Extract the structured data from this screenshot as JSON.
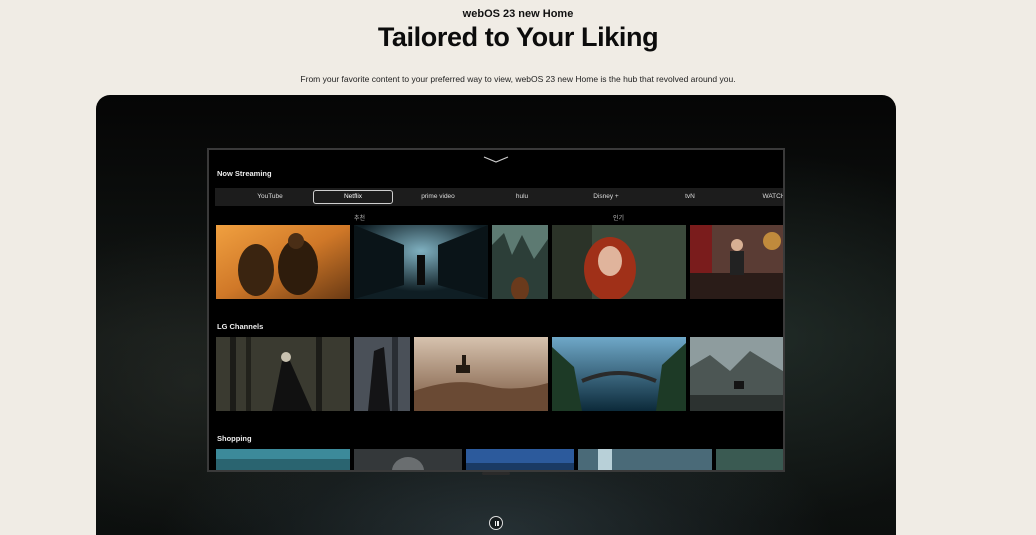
{
  "header": {
    "eyebrow": "webOS 23 new Home",
    "title": "Tailored to Your Liking",
    "description": "From your favorite content to your preferred way to view, webOS 23 new Home is the hub that revolved around you."
  },
  "tv": {
    "now_streaming": {
      "title": "Now Streaming",
      "tabs": [
        {
          "label": "YouTube",
          "active": false
        },
        {
          "label": "Netflix",
          "active": true
        },
        {
          "label": "prime video",
          "active": false
        },
        {
          "label": "hulu",
          "active": false
        },
        {
          "label": "Disney +",
          "active": false
        },
        {
          "label": "tvN",
          "active": false
        },
        {
          "label": "WATCH",
          "active": false
        }
      ],
      "subheads": [
        "추천",
        "인기"
      ]
    },
    "lg_channels": {
      "title": "LG Channels"
    },
    "shopping": {
      "title": "Shopping"
    }
  },
  "controls": {
    "pause_icon": "pause-icon"
  },
  "colors": {
    "page_bg": "#f0ece5",
    "stage_bg": "#0a0c0b",
    "tv_bg": "#000000"
  }
}
